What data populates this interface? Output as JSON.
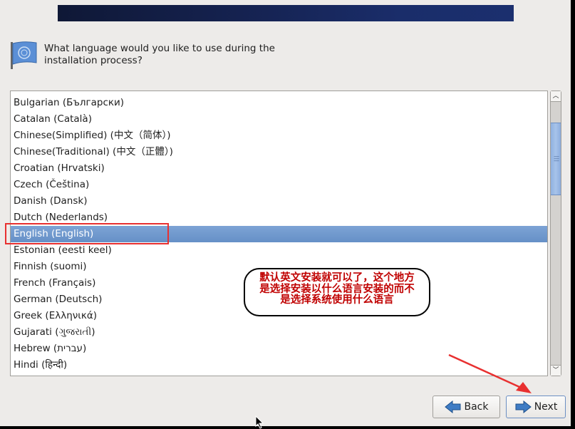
{
  "header": {
    "question": "What language would you like to use during the installation process?"
  },
  "languages": [
    {
      "label": "Bulgarian (Български)",
      "selected": false
    },
    {
      "label": "Catalan (Català)",
      "selected": false
    },
    {
      "label": "Chinese(Simplified) (中文（简体）)",
      "selected": false
    },
    {
      "label": "Chinese(Traditional) (中文（正體）)",
      "selected": false
    },
    {
      "label": "Croatian (Hrvatski)",
      "selected": false
    },
    {
      "label": "Czech (Čeština)",
      "selected": false
    },
    {
      "label": "Danish (Dansk)",
      "selected": false
    },
    {
      "label": "Dutch (Nederlands)",
      "selected": false
    },
    {
      "label": "English (English)",
      "selected": true
    },
    {
      "label": "Estonian (eesti keel)",
      "selected": false
    },
    {
      "label": "Finnish (suomi)",
      "selected": false
    },
    {
      "label": "French (Français)",
      "selected": false
    },
    {
      "label": "German (Deutsch)",
      "selected": false
    },
    {
      "label": "Greek (Ελληνικά)",
      "selected": false
    },
    {
      "label": "Gujarati (ગુજરાતી)",
      "selected": false
    },
    {
      "label": "Hebrew (עברית)",
      "selected": false
    },
    {
      "label": "Hindi (हिन्दी)",
      "selected": false
    }
  ],
  "buttons": {
    "back": "Back",
    "next": "Next"
  },
  "annotation": {
    "lines": [
      "默认英文安装就可以了，这个地方",
      "是选择安装以什么语言安装的而不",
      "是选择系统使用什么语言"
    ]
  },
  "colors": {
    "selection": "#7199cd",
    "annotation_red": "#c00000",
    "highlight_box": "#e83030"
  }
}
